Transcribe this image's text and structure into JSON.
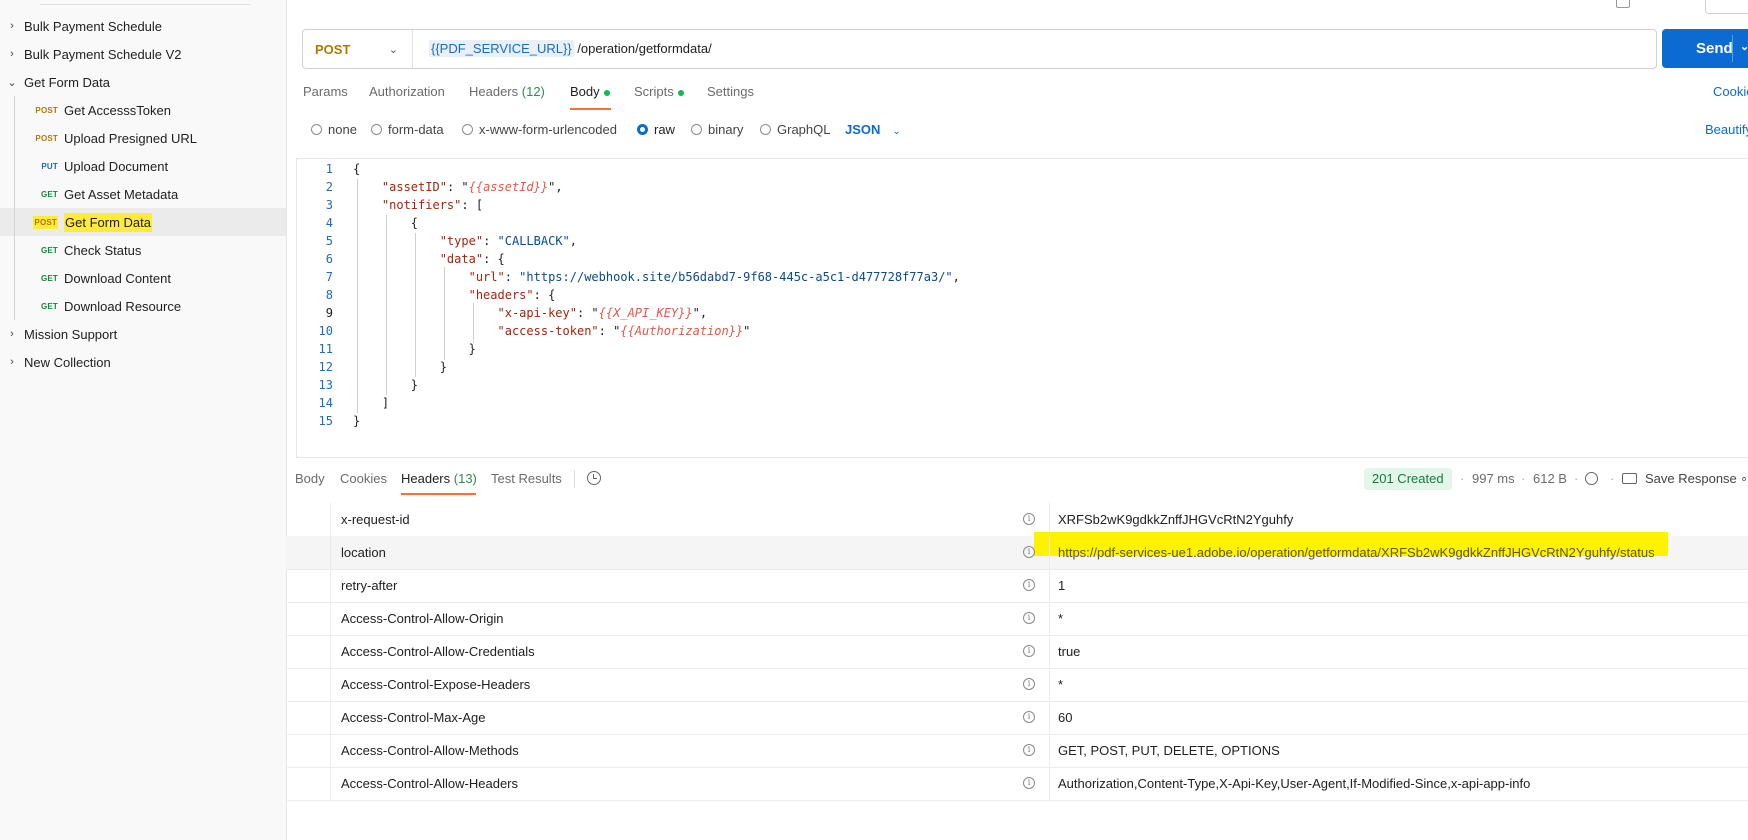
{
  "sidebar": {
    "folders_top": [
      {
        "label": "Bulk Payment Schedule"
      },
      {
        "label": "Bulk Payment Schedule V2"
      },
      {
        "label": "Get Form Data"
      }
    ],
    "requests": [
      {
        "method": "POST",
        "label": "Get AccesssToken"
      },
      {
        "method": "POST",
        "label": "Upload Presigned URL"
      },
      {
        "method": "PUT",
        "label": "Upload Document"
      },
      {
        "method": "GET",
        "label": "Get Asset Metadata"
      },
      {
        "method": "POST",
        "label": "Get Form Data"
      },
      {
        "method": "GET",
        "label": "Check Status"
      },
      {
        "method": "GET",
        "label": "Download Content"
      },
      {
        "method": "GET",
        "label": "Download Resource"
      }
    ],
    "folders_bottom": [
      {
        "label": "Mission Support"
      },
      {
        "label": "New Collection"
      }
    ]
  },
  "request": {
    "method": "POST",
    "url_var": "{{PDF_SERVICE_URL}}",
    "url_path": " /operation/getformdata/",
    "send_label": "Send"
  },
  "request_tabs": {
    "params": "Params",
    "authorization": "Authorization",
    "headers": "Headers",
    "headers_count": "(12)",
    "body": "Body",
    "scripts": "Scripts",
    "settings": "Settings",
    "cookies": "Cookie"
  },
  "body_types": {
    "none": "none",
    "form_data": "form-data",
    "urlencoded": "x-www-form-urlencoded",
    "raw": "raw",
    "binary": "binary",
    "graphql": "GraphQL",
    "format": "JSON",
    "beautify": "Beautify"
  },
  "editor": {
    "line_numbers": [
      "1",
      "2",
      "3",
      "4",
      "5",
      "6",
      "7",
      "8",
      "9",
      "10",
      "11",
      "12",
      "13",
      "14",
      "15"
    ],
    "k_assetID": "\"assetID\"",
    "v_assetId": "{{assetId}}",
    "k_notifiers": "\"notifiers\"",
    "k_type": "\"type\"",
    "s_callback": "\"CALLBACK\"",
    "k_data": "\"data\"",
    "k_url": "\"url\"",
    "s_url": "\"https://webhook.site/b56dabd7-9f68-445c-a5c1-d477728f77a3/\"",
    "k_headers": "\"headers\"",
    "k_xapikey": "\"x-api-key\"",
    "v_xapikey": "{{X_API_KEY}}",
    "k_accesstoken": "\"access-token\"",
    "v_authorization": "{{Authorization}}"
  },
  "response": {
    "tabs": {
      "body": "Body",
      "cookies": "Cookies",
      "headers": "Headers",
      "headers_count": "(13)",
      "test_results": "Test Results"
    },
    "status": "201 Created",
    "time": "997 ms",
    "size": "612 B",
    "save_response": "Save Response",
    "headers": [
      {
        "key": "x-request-id",
        "value": "XRFSb2wK9gdkkZnffJHGVcRtN2Yguhfy"
      },
      {
        "key": "location",
        "value": "https://pdf-services-ue1.adobe.io/operation/getformdata/XRFSb2wK9gdkkZnffJHGVcRtN2Yguhfy/status"
      },
      {
        "key": "retry-after",
        "value": "1"
      },
      {
        "key": "Access-Control-Allow-Origin",
        "value": "*"
      },
      {
        "key": "Access-Control-Allow-Credentials",
        "value": "true"
      },
      {
        "key": "Access-Control-Expose-Headers",
        "value": "*"
      },
      {
        "key": "Access-Control-Max-Age",
        "value": "60"
      },
      {
        "key": "Access-Control-Allow-Methods",
        "value": "GET, POST, PUT, DELETE, OPTIONS"
      },
      {
        "key": "Access-Control-Allow-Headers",
        "value": "Authorization,Content-Type,X-Api-Key,User-Agent,If-Modified-Since,x-api-app-info"
      }
    ]
  },
  "colors": {
    "post": "#ad7a03",
    "get": "#0e8a3e",
    "put": "#1f6bba",
    "accent": "#ff6c37",
    "send": "#0b6bd3"
  },
  "icons": {
    "folder_chevron": "chevron-right-icon",
    "expanded_chevron": "chevron-down-icon",
    "history": "history-icon",
    "info": "info-icon",
    "globe": "globe-icon",
    "save": "save-icon",
    "more": "more-icon"
  }
}
